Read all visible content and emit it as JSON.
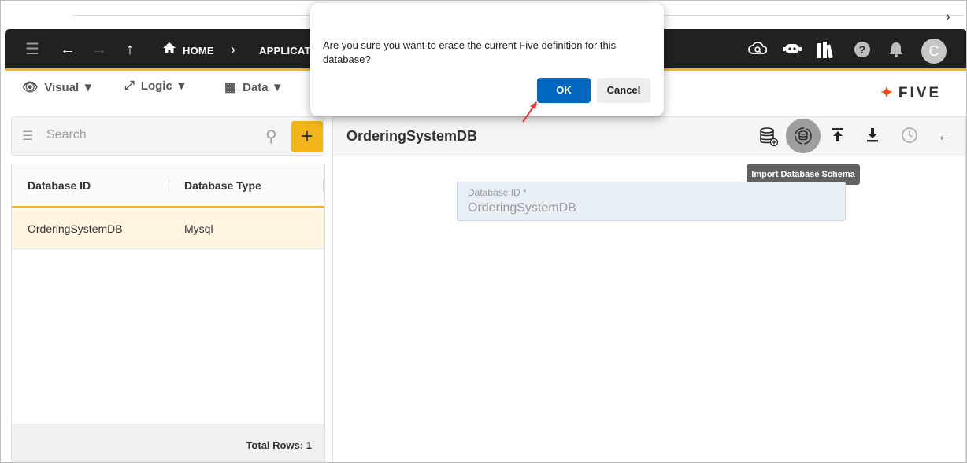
{
  "colors": {
    "accent": "#f2b51c",
    "topbar": "#212121",
    "ok_button": "#0067c0",
    "row_selected": "#fff5e1",
    "annotation": "#e53935"
  },
  "browser": {
    "next_icon": "chevron-right-icon"
  },
  "topbar": {
    "home_label": "HOME",
    "breadcrumb_item": "APPLICATI",
    "avatar_initial": "C",
    "icons": [
      "menu-icon",
      "back-arrow-icon",
      "forward-arrow-icon",
      "up-arrow-icon",
      "home-icon",
      "cloud-search-icon",
      "chatbot-icon",
      "books-icon",
      "help-icon",
      "bell-icon"
    ]
  },
  "menubar": {
    "items": [
      {
        "label": "Visual ▼",
        "icon": "eye-icon"
      },
      {
        "label": "Logic ▼",
        "icon": "logic-flow-icon"
      },
      {
        "label": "Data ▼",
        "icon": "table-icon"
      }
    ],
    "logo_text": "FIVE"
  },
  "search": {
    "placeholder": "Search"
  },
  "grid": {
    "columns": [
      "Database ID",
      "Database Type"
    ],
    "rows": [
      {
        "id": "OrderingSystemDB",
        "type": "Mysql"
      }
    ],
    "footer": "Total Rows: 1"
  },
  "detail": {
    "title": "OrderingSystemDB",
    "tooltip": "Import Database Schema",
    "field": {
      "label": "Database ID *",
      "value": "OrderingSystemDB"
    }
  },
  "dialog": {
    "message": "Are you sure you want to erase the current Five definition for this database?",
    "ok_label": "OK",
    "cancel_label": "Cancel"
  }
}
